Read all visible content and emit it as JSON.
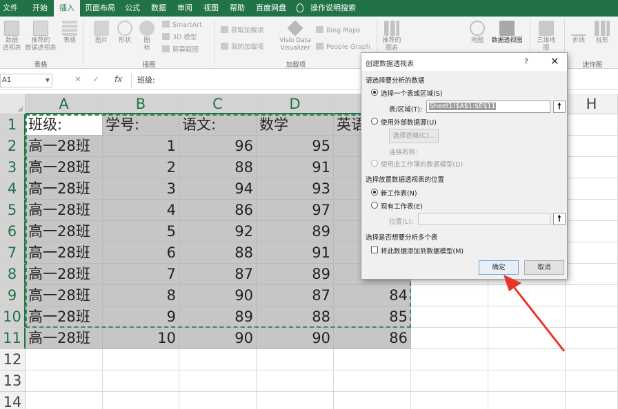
{
  "ribbon_tabs": [
    "文件",
    "开始",
    "插入",
    "页面布局",
    "公式",
    "数据",
    "审阅",
    "视图",
    "帮助",
    "百度网盘",
    "操作说明搜索"
  ],
  "active_tab": "插入",
  "ribbon": {
    "tables_group": {
      "label": "表格",
      "pivot": "数据\n透视表",
      "recommended": "推荐的\n数据透视表",
      "table": "表格"
    },
    "illustrations_group": {
      "label": "插图",
      "picture": "图片",
      "shape": "形状",
      "icon": "图\n标",
      "smartart": "SmartArt",
      "model3d": "3D 模型",
      "screenshot": "屏幕截图"
    },
    "addins_group": {
      "label": "加载项",
      "get_addins": "获取加载项",
      "my_addins": "我的加载项",
      "visio": "Visio Data\nVisualizer",
      "bing": "Bing Maps",
      "people": "People Graph"
    },
    "charts_group": {
      "recommended": "推荐的\n图表",
      "map": "地图",
      "pivot_chart": "数据透视图"
    },
    "tours_group": {
      "map3d": "三维地\n图"
    },
    "sparklines_group": {
      "label": "迷你图",
      "line": "折线",
      "column": "柱形"
    }
  },
  "formula_bar": {
    "namebox": "A1",
    "fx": "fx",
    "content": "班级:"
  },
  "columns": [
    "A",
    "B",
    "C",
    "D",
    "E",
    "F",
    "G",
    "H"
  ],
  "rows": [
    "1",
    "2",
    "3",
    "4",
    "5",
    "6",
    "7",
    "8",
    "9",
    "10",
    "11",
    "12",
    "13",
    "14"
  ],
  "headers": [
    "班级:",
    "学号:",
    "语文:",
    "数学",
    "英语:"
  ],
  "data_rows": [
    [
      "高一28班",
      "1",
      "96",
      "95",
      ""
    ],
    [
      "高一28班",
      "2",
      "88",
      "91",
      ""
    ],
    [
      "高一28班",
      "3",
      "94",
      "93",
      ""
    ],
    [
      "高一28班",
      "4",
      "86",
      "97",
      ""
    ],
    [
      "高一28班",
      "5",
      "92",
      "89",
      ""
    ],
    [
      "高一28班",
      "6",
      "88",
      "91",
      ""
    ],
    [
      "高一28班",
      "7",
      "87",
      "89",
      ""
    ],
    [
      "高一28班",
      "8",
      "90",
      "87",
      "84"
    ],
    [
      "高一28班",
      "9",
      "89",
      "88",
      "85"
    ],
    [
      "高一28班",
      "10",
      "90",
      "90",
      "86"
    ]
  ],
  "dialog": {
    "title": "创建数据透视表",
    "help": "?",
    "close": "✕",
    "section1": "请选择要分析的数据",
    "opt_range": "选择一个表或区域(S)",
    "range_label": "表/区域(T):",
    "range_value": "Sheet1!$A$1:$E$11",
    "opt_external": "使用外部数据源(U)",
    "choose_conn": "选择连接(C)...",
    "conn_name": "连接名称:",
    "opt_model": "使用此工作簿的数据模型(D)",
    "section2": "选择放置数据透视表的位置",
    "opt_new": "新工作表(N)",
    "opt_existing": "现有工作表(E)",
    "location_label": "位置(L):",
    "location_value": "",
    "section3": "选择是否想要分析多个表",
    "add_model": "将此数据添加到数据模型(M)",
    "ok": "确定",
    "cancel": "取消"
  },
  "colors": {
    "accent": "#217346",
    "selection": "#c6c6c6",
    "arrow": "#e8342a"
  }
}
